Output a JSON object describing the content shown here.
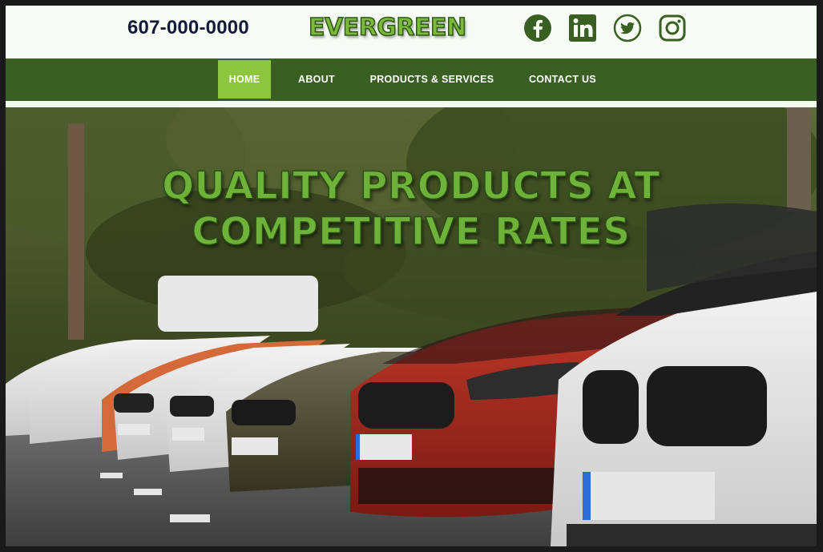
{
  "header": {
    "phone": "607-000-0000",
    "logo": "EVERGREEN",
    "socials": [
      {
        "icon": "facebook-icon"
      },
      {
        "icon": "linkedin-icon"
      },
      {
        "icon": "twitter-icon"
      },
      {
        "icon": "instagram-icon"
      }
    ]
  },
  "nav": {
    "items": [
      {
        "label": "HOME",
        "active": true
      },
      {
        "label": "ABOUT",
        "active": false
      },
      {
        "label": "PRODUCTS & SERVICES",
        "active": false
      },
      {
        "label": "CONTACT US",
        "active": false
      }
    ]
  },
  "hero": {
    "line1": "QUALITY PRODUCTS AT",
    "line2": "COMPETITIVE RATES"
  },
  "colors": {
    "nav_bg": "#3a5f23",
    "nav_active": "#8cc63f",
    "accent_green": "#6fb23a",
    "social_green": "#3a5f23"
  }
}
